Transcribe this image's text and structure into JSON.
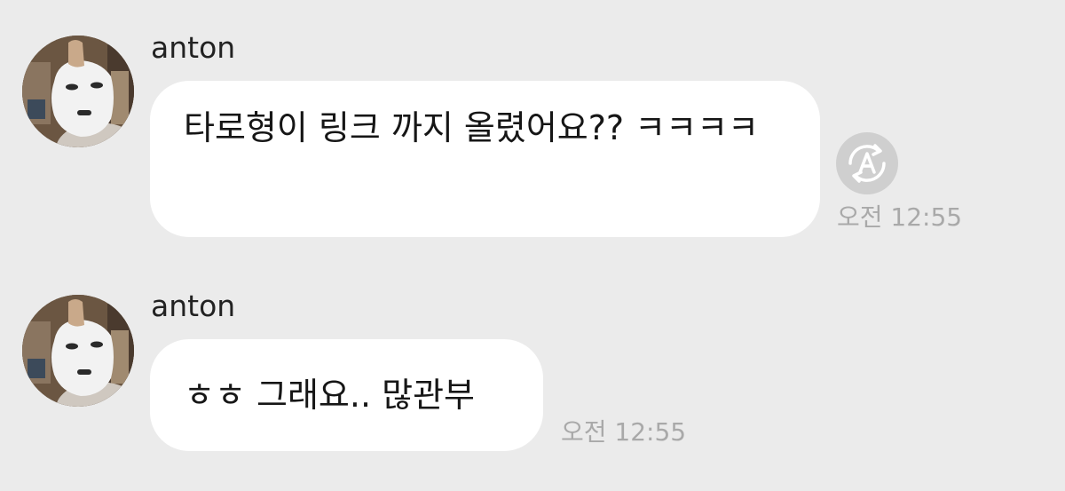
{
  "messages": [
    {
      "sender": "anton",
      "text": "타로형이 링크 까지 올렸어요?? ㅋㅋㅋㅋ",
      "time": "오전 12:55",
      "has_translate_icon": true
    },
    {
      "sender": "anton",
      "text": "ㅎㅎ 그래요.. 많관부",
      "time": "오전 12:55",
      "has_translate_icon": false
    }
  ],
  "colors": {
    "background": "#ebebeb",
    "bubble": "#ffffff",
    "timestamp": "#a9a9a9",
    "translate_icon_bg": "#cfcfcf"
  },
  "icons": {
    "translate": "auto-translate-icon"
  }
}
